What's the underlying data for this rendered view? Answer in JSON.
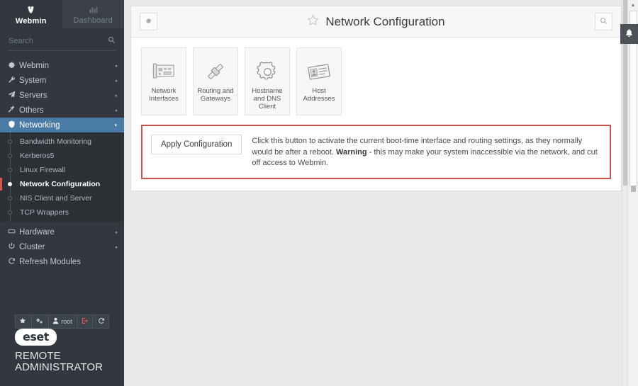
{
  "sidebar": {
    "tabs": [
      {
        "label": "Webmin",
        "icon": "webmin-logo-icon",
        "glyph": "☸",
        "active": true
      },
      {
        "label": "Dashboard",
        "icon": "chart-icon",
        "glyph": "ᴴ",
        "active": false
      }
    ],
    "search": {
      "placeholder": "Search",
      "value": "",
      "icon": "search-icon"
    },
    "nav": [
      {
        "label": "Webmin",
        "icon": "gear-icon",
        "glyph": "⚙",
        "caret": "◂",
        "name": "webmin"
      },
      {
        "label": "System",
        "icon": "wrench-icon",
        "glyph": "ὒ7",
        "caret": "◂",
        "name": "system"
      },
      {
        "label": "Servers",
        "icon": "paper-plane-icon",
        "glyph": "➤",
        "caret": "◂",
        "name": "servers"
      },
      {
        "label": "Others",
        "icon": "hammer-icon",
        "glyph": "⚒",
        "caret": "◂",
        "name": "others"
      },
      {
        "label": "Networking",
        "icon": "shield-icon",
        "glyph": "⛊",
        "caret": "▾",
        "name": "networking",
        "active": true
      },
      {
        "label": "Hardware",
        "icon": "printer-icon",
        "glyph": "⎙",
        "caret": "◂",
        "name": "hardware"
      },
      {
        "label": "Cluster",
        "icon": "power-icon",
        "glyph": "⏻",
        "caret": "◂",
        "name": "cluster"
      },
      {
        "label": "Refresh Modules",
        "icon": "refresh-icon",
        "glyph": "↻",
        "caret": "",
        "name": "refresh-modules"
      }
    ],
    "submenu": [
      {
        "label": "Bandwidth Monitoring",
        "current": false
      },
      {
        "label": "Kerberos5",
        "current": false
      },
      {
        "label": "Linux Firewall",
        "current": false
      },
      {
        "label": "Network Configuration",
        "current": true
      },
      {
        "label": "NIS Client and Server",
        "current": false
      },
      {
        "label": "TCP Wrappers",
        "current": false
      }
    ],
    "footer_tools": [
      {
        "icon": "star-icon",
        "glyph": "★",
        "label": "",
        "name": "favorites-button"
      },
      {
        "icon": "gears-icon",
        "glyph": "⚙",
        "label": "",
        "name": "settings-button"
      },
      {
        "icon": "user-icon",
        "glyph": "▴",
        "label": "root",
        "name": "user-button"
      },
      {
        "icon": "logout-icon",
        "glyph": "→",
        "label": "",
        "name": "logout-button"
      },
      {
        "icon": "refresh-icon",
        "glyph": "↻",
        "label": "",
        "name": "refresh-button"
      }
    ],
    "logo": {
      "badge": "eset",
      "line1": "REMOTE",
      "line2": "ADMINISTRATOR"
    }
  },
  "header": {
    "gear_icon": "gear-icon",
    "gear_glyph": "⚙",
    "star_icon": "star-outline-icon",
    "star_glyph": "☆",
    "title": "Network Configuration",
    "search_icon": "search-icon",
    "search_glyph": "⌕"
  },
  "modules": [
    {
      "label": "Network Interfaces",
      "icon": "network-card-icon"
    },
    {
      "label": "Routing and Gateways",
      "icon": "route-pipe-icon"
    },
    {
      "label": "Hostname and DNS Client",
      "icon": "gear-3d-icon"
    },
    {
      "label": "Host Addresses",
      "icon": "id-card-icon"
    }
  ],
  "apply": {
    "button_label": "Apply Configuration",
    "text_before": "Click this button to activate the current boot-time interface and routing settings, as they normally would be after a reboot. ",
    "warning_label": "Warning",
    "text_after": " - this may make your system inaccessible via the network, and cut off access to Webmin."
  },
  "notification": {
    "icon": "bell-icon",
    "glyph": "ὑ4"
  },
  "colors": {
    "sidebar_bg": "#32383e",
    "sidebar_sub_bg": "#2c3136",
    "accent_active": "#4a7ba7",
    "warning_border": "#c9534f",
    "current_marker": "#d9534f",
    "content_bg": "#e9e9e9",
    "panel_bg": "#ffffff"
  }
}
